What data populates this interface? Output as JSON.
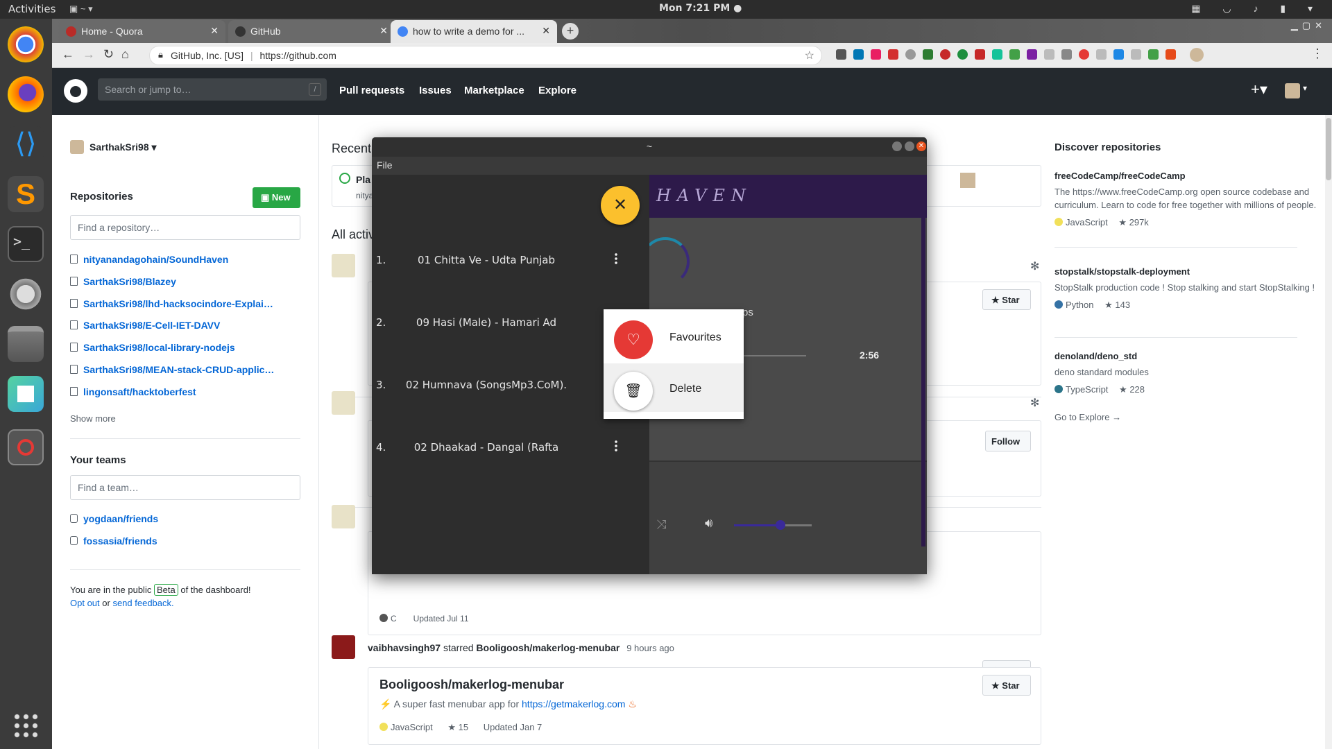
{
  "topbar": {
    "activities": "Activities",
    "clock": "Mon  7:21 PM ●"
  },
  "dock": {
    "items": [
      "chrome-icon",
      "firefox-icon",
      "vscode-icon",
      "sublime-icon",
      "terminal-icon",
      "video-icon",
      "files-icon",
      "app-icon",
      "blocked-icon"
    ]
  },
  "browser": {
    "tabs": [
      {
        "label": "Home - Quora",
        "color": "#b92b27"
      },
      {
        "label": "GitHub",
        "color": "#333333"
      },
      {
        "label": "how to write a demo for ...",
        "color": "#4285f4"
      }
    ],
    "site_identity": "GitHub, Inc. [US]",
    "url": "https://github.com"
  },
  "github": {
    "search_placeholder": "Search or jump to…",
    "search_key": "/",
    "nav": [
      "Pull requests",
      "Issues",
      "Marketplace",
      "Explore"
    ],
    "user": "SarthakSri98",
    "repos_heading": "Repositories",
    "new_button": "New",
    "repo_search_placeholder": "Find a repository…",
    "repos": [
      "nityanandagohain/SoundHaven",
      "SarthakSri98/Blazey",
      "SarthakSri98/lhd-hacksocindore-Explai…",
      "SarthakSri98/E-Cell-IET-DAVV",
      "SarthakSri98/local-library-nodejs",
      "SarthakSri98/MEAN-stack-CRUD-applic…",
      "lingonsaft/hacktoberfest"
    ],
    "show_more": "Show more",
    "teams_heading": "Your teams",
    "team_search_placeholder": "Find a team…",
    "teams": [
      "yogdaan/friends",
      "fossasia/friends"
    ],
    "beta_notice": {
      "prefix": "You are in the public",
      "badge": "Beta",
      "suffix": "of the dashboard!",
      "opt_out": "Opt out",
      "or": "or",
      "feedback": "send feedback."
    },
    "recent_heading": "Recent",
    "recent_item": "Pla",
    "recent_sub": "nitya",
    "all_activity": "All activ",
    "feed": {
      "star_label": "Star",
      "follow_label": "Follow",
      "lang_c": "C",
      "updated_c": "Updated Jul 11",
      "actor": "vaibhavsingh97",
      "verb": "starred",
      "target": "Booligoosh/makerlog-menubar",
      "time": "9 hours ago",
      "repo_title": "Booligoosh/makerlog-menubar",
      "repo_desc": "A super fast menubar app for",
      "repo_link": "https://getmakerlog.com",
      "repo_lang": "JavaScript",
      "repo_stars": "15",
      "repo_updated": "Updated Jan 7"
    },
    "discover": {
      "heading": "Discover repositories",
      "repos": [
        {
          "name": "freeCodeCamp/freeCodeCamp",
          "desc": "The https://www.freeCodeCamp.org open source codebase and curriculum. Learn to code for free together with millions of people.",
          "lang": "JavaScript",
          "lang_color": "#f1e05a",
          "stars": "297k"
        },
        {
          "name": "stopstalk/stopstalk-deployment",
          "desc": "StopStalk production code ! Stop stalking and start StopStalking !",
          "lang": "Python",
          "lang_color": "#3572A5",
          "stars": "143"
        },
        {
          "name": "denoland/deno_std",
          "desc": "deno standard modules",
          "lang": "TypeScript",
          "lang_color": "#2b7489",
          "stars": "228"
        }
      ],
      "explore": "Go to Explore →"
    }
  },
  "music_app": {
    "title": "~",
    "menu": "File",
    "brand": "HAVEN",
    "songs": [
      {
        "n": "1.",
        "title": "01 Chitta Ve - Udta Punjab"
      },
      {
        "n": "2.",
        "title": "09 Hasi (Male) - Hamari Ad"
      },
      {
        "n": "3.",
        "title": "02 Humnava (SongsMp3.CoM)."
      },
      {
        "n": "4.",
        "title": "02 Dhaakad - Dangal (Rafta"
      }
    ],
    "time": "2:56",
    "time_fragment": "ps",
    "volume": 0.6,
    "context_menu": [
      {
        "label": "Favourites",
        "icon": "heart-icon"
      },
      {
        "label": "Delete",
        "icon": "trash-icon"
      }
    ]
  }
}
